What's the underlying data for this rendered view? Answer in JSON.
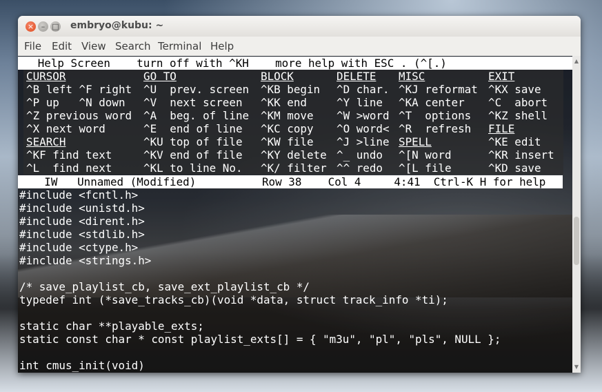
{
  "window": {
    "title": "embryo@kubu: ~",
    "buttons": {
      "close": "×",
      "minimize": "–",
      "maximize": "□"
    }
  },
  "menu": [
    "File",
    "Edit",
    "View",
    "Search",
    "Terminal",
    "Help"
  ],
  "editor": {
    "help_title": "   Help Screen    turn off with ^KH    more help with ESC . (^[.)",
    "help_headers": [
      "CURSOR",
      "GO TO",
      "BLOCK",
      "DELETE",
      "MISC",
      "EXIT"
    ],
    "help_rows": [
      [
        "^B left ^F right",
        "^U  prev. screen",
        "^KB begin",
        "^D char.",
        "^KJ reformat",
        "^KX save"
      ],
      [
        "^P up   ^N down",
        "^V  next screen",
        "^KK end",
        "^Y line",
        "^KA center",
        "^C  abort"
      ],
      [
        "^Z previous word",
        "^A  beg. of line",
        "^KM move",
        "^W >word",
        "^T  options",
        "^KZ shell"
      ],
      [
        "^X next word",
        "^E  end of line",
        "^KC copy",
        "^O word<",
        "^R  refresh",
        "FILE"
      ],
      [
        "SEARCH",
        "^KU top of file",
        "^KW file",
        "^J >line",
        "SPELL",
        "^KE edit"
      ],
      [
        "^KF find text",
        "^KV end of file",
        "^KY delete",
        "^_ undo",
        "^[N word",
        "^KR insert"
      ],
      [
        "^L  find next",
        "^KL to line No.",
        "^K/ filter",
        "^^ redo",
        "^[L file",
        "^KD save"
      ]
    ],
    "status_line": "    IW   Unnamed (Modified)          Row 38    Col 4     4:41  Ctrl-K H for help",
    "code_lines": [
      "#include <fcntl.h>",
      "#include <unistd.h>",
      "#include <dirent.h>",
      "#include <stdlib.h>",
      "#include <ctype.h>",
      "#include <strings.h>",
      "",
      "/* save_playlist_cb, save_ext_playlist_cb */",
      "typedef int (*save_tracks_cb)(void *data, struct track_info *ti);",
      "",
      "static char **playable_exts;",
      "static const char * const playlist_exts[] = { \"m3u\", \"pl\", \"pls\", NULL };",
      "",
      "int cmus_init(void)"
    ]
  }
}
